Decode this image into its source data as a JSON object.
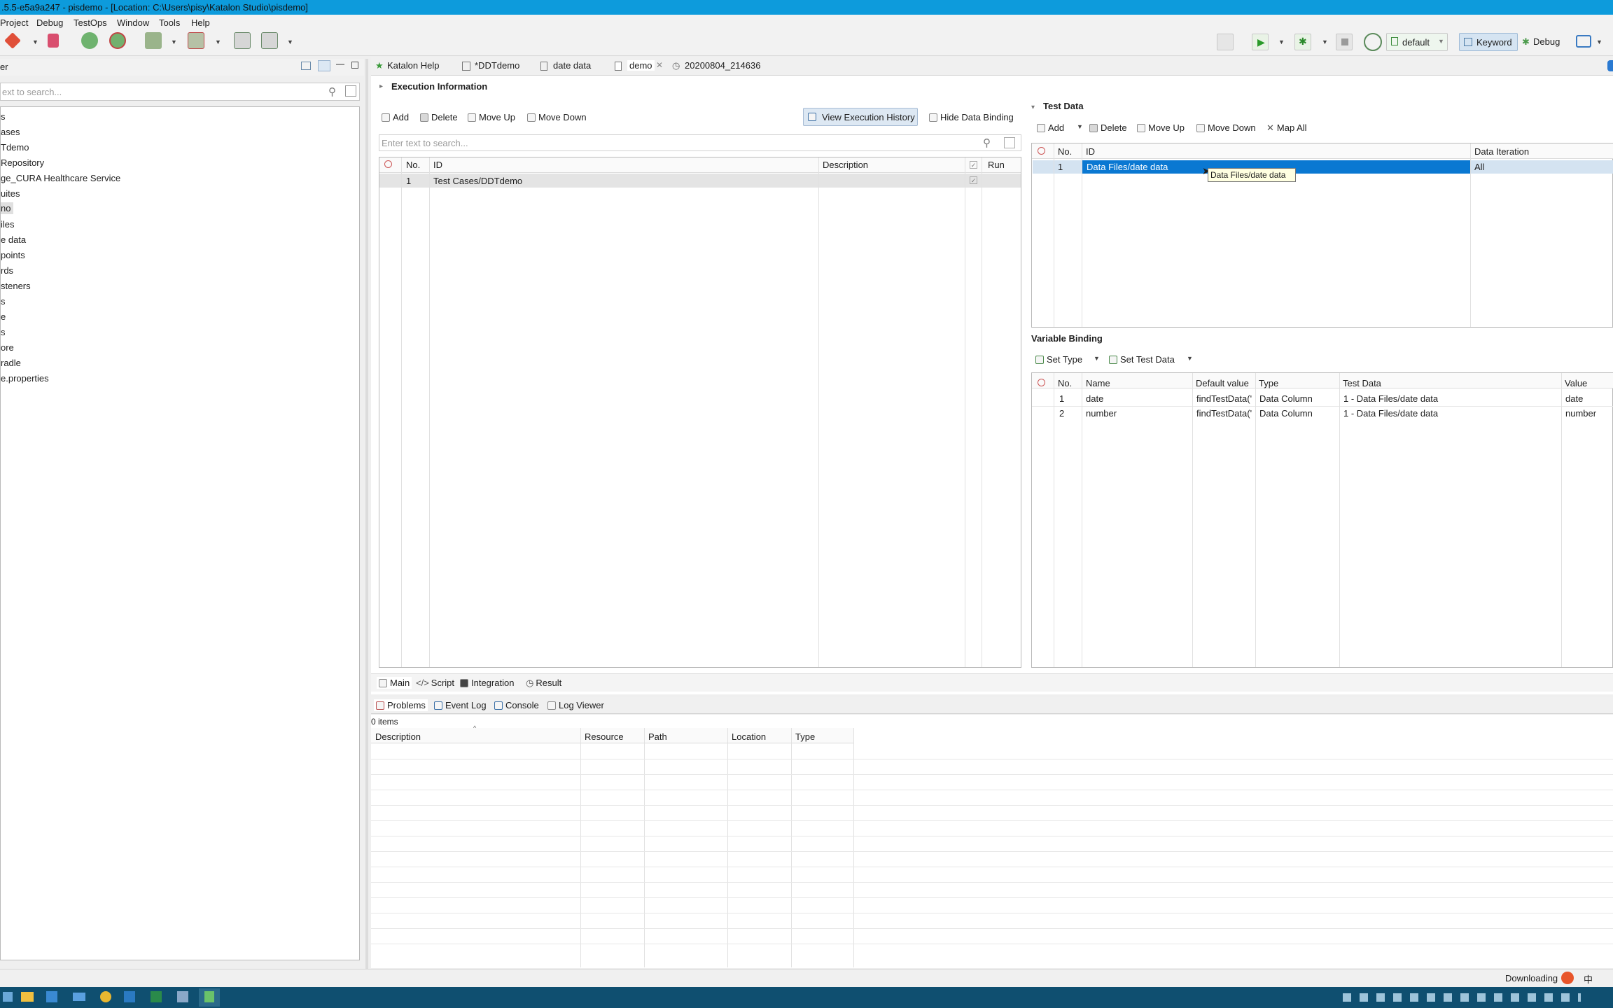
{
  "window_title": ".5.5-e5a9a247 - pisdemo - [Location: C:\\Users\\pisy\\Katalon Studio\\pisdemo]",
  "menu": [
    "Project",
    "Debug",
    "TestOps",
    "Window",
    "Tools",
    "Help"
  ],
  "toolbar_right": {
    "profile": "default",
    "keyword": "Keyword",
    "debug": "Debug"
  },
  "left_panel": {
    "title": "er",
    "search_placeholder": "ext to search...",
    "tree": [
      "s",
      "ases",
      "Tdemo",
      "Repository",
      "ge_CURA Healthcare Service",
      "uites",
      "no",
      "iles",
      "e data",
      "points",
      "rds",
      "steners",
      "s",
      "e",
      "s",
      "ore",
      "radle",
      "e.properties"
    ]
  },
  "editor_tabs": [
    "Katalon Help",
    "*DDTdemo",
    "date data",
    "demo",
    "20200804_214636"
  ],
  "execution_info_label": "Execution Information",
  "left_toolbar": {
    "add": "Add",
    "delete": "Delete",
    "move_up": "Move Up",
    "move_down": "Move Down",
    "view_history": "View Execution History",
    "hide_binding": "Hide Data Binding"
  },
  "search_placeholder": "Enter text to search...",
  "test_table": {
    "headers": [
      "No.",
      "ID",
      "Description",
      "Run"
    ],
    "rows": [
      {
        "no": "1",
        "id": "Test Cases/DDTdemo",
        "description": ""
      }
    ]
  },
  "test_data": {
    "title": "Test Data",
    "toolbar": {
      "add": "Add",
      "delete": "Delete",
      "move_up": "Move Up",
      "move_down": "Move Down",
      "map_all": "Map All"
    },
    "headers": [
      "No.",
      "ID",
      "Data Iteration"
    ],
    "rows": [
      {
        "no": "1",
        "id": "Data Files/date data",
        "iteration": "All"
      }
    ],
    "tooltip": "Data Files/date data"
  },
  "variable_binding": {
    "title": "Variable Binding",
    "toolbar": {
      "set_type": "Set Type",
      "set_test_data": "Set Test Data"
    },
    "headers": [
      "No.",
      "Name",
      "Default value",
      "Type",
      "Test Data",
      "Value"
    ],
    "rows": [
      {
        "no": "1",
        "name": "date",
        "default": "findTestData('",
        "type": "Data Column",
        "test_data": "1 - Data Files/date data",
        "value": "date"
      },
      {
        "no": "2",
        "name": "number",
        "default": "findTestData('",
        "type": "Data Column",
        "test_data": "1 - Data Files/date data",
        "value": "number"
      }
    ]
  },
  "bottom_tabs": [
    "Main",
    "Script",
    "Integration",
    "Result"
  ],
  "console_tabs": [
    "Problems",
    "Event Log",
    "Console",
    "Log Viewer"
  ],
  "problems": {
    "count": "0 items",
    "headers": [
      "Description",
      "Resource",
      "Path",
      "Location",
      "Type"
    ]
  },
  "status": {
    "downloading": "Downloading",
    "ime": "中"
  },
  "colors": {
    "title_bar": "#0d9bdc",
    "selection": "#0a78d2",
    "taskbar": "#0f4f70"
  }
}
